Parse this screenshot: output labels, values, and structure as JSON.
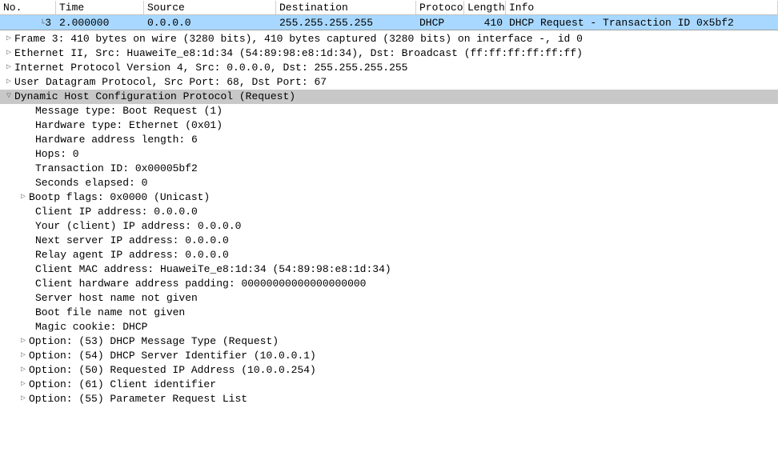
{
  "columns": {
    "no": "No.",
    "time": "Time",
    "source": "Source",
    "dest": "Destination",
    "proto": "Protocol",
    "length": "Length",
    "info": "Info"
  },
  "packet": {
    "no": "3",
    "time": "2.000000",
    "source": "0.0.0.0",
    "dest": "255.255.255.255",
    "proto": "DHCP",
    "length": "410",
    "info": "DHCP Request  - Transaction ID 0x5bf2"
  },
  "tree": {
    "frame": "Frame 3: 410 bytes on wire (3280 bits), 410 bytes captured (3280 bits) on interface -, id 0",
    "eth": "Ethernet II, Src: HuaweiTe_e8:1d:34 (54:89:98:e8:1d:34), Dst: Broadcast (ff:ff:ff:ff:ff:ff)",
    "ip": "Internet Protocol Version 4, Src: 0.0.0.0, Dst: 255.255.255.255",
    "udp": "User Datagram Protocol, Src Port: 68, Dst Port: 67",
    "dhcp": "Dynamic Host Configuration Protocol (Request)",
    "msgtype": "Message type: Boot Request (1)",
    "hwtype": "Hardware type: Ethernet (0x01)",
    "hwlen": "Hardware address length: 6",
    "hops": "Hops: 0",
    "xid": "Transaction ID: 0x00005bf2",
    "secs": "Seconds elapsed: 0",
    "flags": "Bootp flags: 0x0000 (Unicast)",
    "ciaddr": "Client IP address: 0.0.0.0",
    "yiaddr": "Your (client) IP address: 0.0.0.0",
    "siaddr": "Next server IP address: 0.0.0.0",
    "giaddr": "Relay agent IP address: 0.0.0.0",
    "chaddr": "Client MAC address: HuaweiTe_e8:1d:34 (54:89:98:e8:1d:34)",
    "padding": "Client hardware address padding: 00000000000000000000",
    "sname": "Server host name not given",
    "file": "Boot file name not given",
    "magic": "Magic cookie: DHCP",
    "opt53": "Option: (53) DHCP Message Type (Request)",
    "opt54": "Option: (54) DHCP Server Identifier (10.0.0.1)",
    "opt50": "Option: (50) Requested IP Address (10.0.0.254)",
    "opt61": "Option: (61) Client identifier",
    "opt55": "Option: (55) Parameter Request List"
  }
}
